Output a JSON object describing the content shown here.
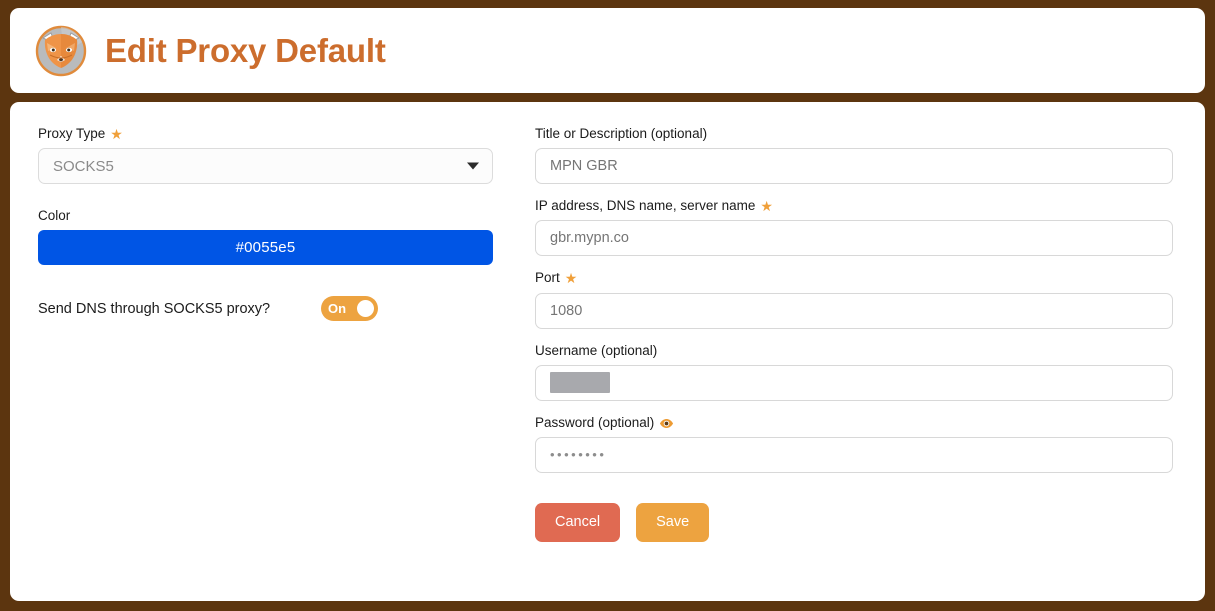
{
  "header": {
    "title": "Edit Proxy Default",
    "logo_icon": "foxyproxy-fox-logo-icon",
    "title_color": "#cc6d2d"
  },
  "theme": {
    "page_background": "#5c350f",
    "card_background": "#ffffff",
    "accent_orange": "#eda340",
    "star_color": "#f0a03a",
    "cancel_color": "#e06a52",
    "save_color": "#eda340"
  },
  "form": {
    "left": {
      "proxy_type": {
        "label": "Proxy Type",
        "required_icon": "star-icon",
        "value": "SOCKS5",
        "dropdown_icon": "chevron-down-icon"
      },
      "color": {
        "label": "Color",
        "value": "#0055e5",
        "swatch_hex": "#0055e5"
      },
      "dns_toggle": {
        "label": "Send DNS through SOCKS5 proxy?",
        "state": "On"
      }
    },
    "right": {
      "title_description": {
        "label": "Title or Description (optional)",
        "placeholder": "MPN GBR"
      },
      "host": {
        "label": "IP address, DNS name, server name",
        "required_icon": "star-icon",
        "placeholder": "gbr.mypn.co"
      },
      "port": {
        "label": "Port",
        "required_icon": "star-icon",
        "placeholder": "1080"
      },
      "username": {
        "label": "Username (optional)",
        "value": "",
        "redacted": true
      },
      "password": {
        "label": "Password (optional)",
        "reveal_icon": "eye-icon",
        "value": "••••••••"
      }
    }
  },
  "buttons": {
    "cancel": "Cancel",
    "save": "Save"
  }
}
